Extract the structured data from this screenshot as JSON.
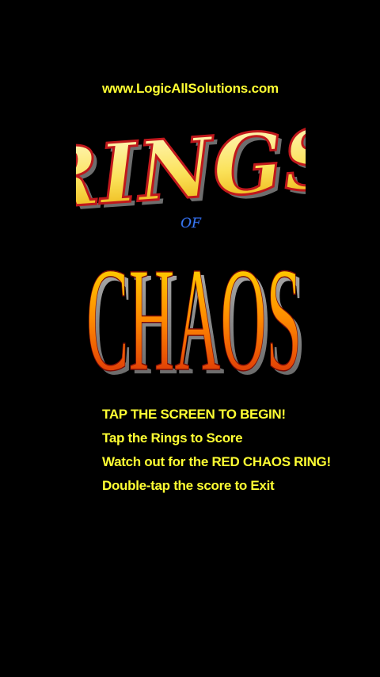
{
  "website": "www.LogicAllSolutions.com",
  "logo": {
    "word1": "RINGS",
    "word2": "OF",
    "word3": "CHAOS"
  },
  "instructions": [
    "TAP THE SCREEN TO BEGIN!",
    "Tap the Rings to Score",
    "Watch out for the RED CHAOS RING!",
    "Double-tap the score to Exit"
  ],
  "colors": {
    "background": "#000000",
    "text": "#ffff33",
    "rings_fill_top": "#fff9b0",
    "rings_fill_bottom": "#f2c500",
    "rings_outline": "#c0181c",
    "chaos_fill_top": "#ffe300",
    "chaos_fill_bottom": "#d51c08",
    "chaos_extrusion": "#8a8a8a",
    "of_color": "#2e6fd8"
  }
}
